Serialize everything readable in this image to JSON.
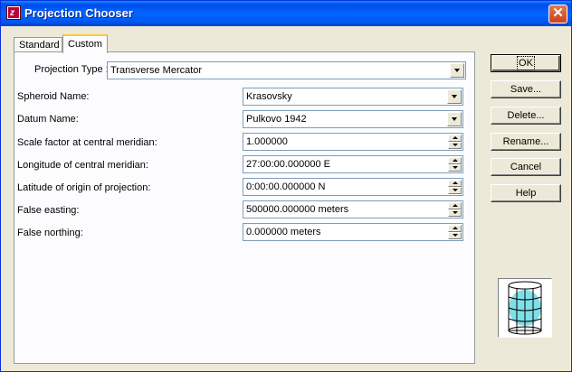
{
  "window": {
    "title": "Projection Chooser",
    "close_label": "✕"
  },
  "tabs": [
    {
      "label": "Standard"
    },
    {
      "label": "Custom"
    }
  ],
  "projection_type": {
    "label": "Projection Type :",
    "value": "Transverse Mercator"
  },
  "fields": {
    "spheroid": {
      "label": "Spheroid Name:",
      "value": "Krasovsky"
    },
    "datum": {
      "label": "Datum Name:",
      "value": "Pulkovo 1942"
    },
    "scale_factor": {
      "label": "Scale factor at central meridian:",
      "value": "1.000000"
    },
    "longitude": {
      "label": "Longitude of central meridian:",
      "value": "27:00:00.000000 E"
    },
    "latitude": {
      "label": "Latitude of origin of projection:",
      "value": "0:00:00.000000 N"
    },
    "false_easting": {
      "label": "False easting:",
      "value": "500000.000000 meters"
    },
    "false_northing": {
      "label": "False northing:",
      "value": "0.000000 meters"
    }
  },
  "buttons": {
    "ok": "OK",
    "save": "Save...",
    "delete": "Delete...",
    "rename": "Rename...",
    "cancel": "Cancel",
    "help": "Help"
  },
  "colors": {
    "title_bar": "#0054e3",
    "dialog_bg": "#ece9d8",
    "globe_fill": "#7fdfe8",
    "tab_highlight": "#ffc83c"
  },
  "icons": {
    "app": "projection-app-icon",
    "preview": "cylinder-projection-icon"
  }
}
